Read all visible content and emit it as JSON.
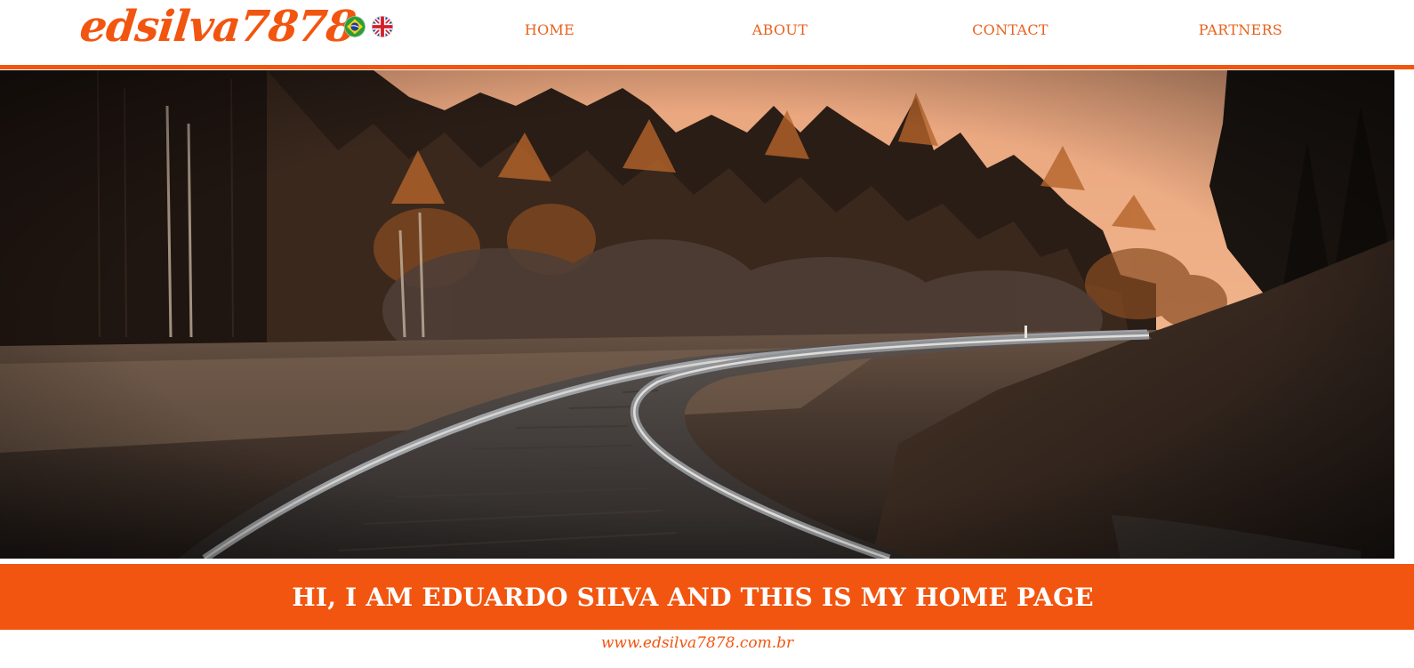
{
  "brand": {
    "logo_text": "edsilva7878",
    "accent_color": "#f2550f",
    "nav_color": "#e8621c"
  },
  "languages": [
    {
      "code": "pt-BR",
      "icon": "brazil-flag-icon"
    },
    {
      "code": "en-GB",
      "icon": "uk-flag-icon"
    }
  ],
  "nav": {
    "home": "HOME",
    "about": "ABOUT",
    "contact": "CONTACT",
    "partners": "PARTNERS"
  },
  "hero": {
    "image_subject": "railway track through autumn forest at sunset"
  },
  "banner": {
    "text": "HI, I AM EDUARDO SILVA AND THIS IS MY HOME PAGE",
    "background": "#f2550f"
  },
  "footer": {
    "url": "www.edsilva7878.com.br"
  }
}
